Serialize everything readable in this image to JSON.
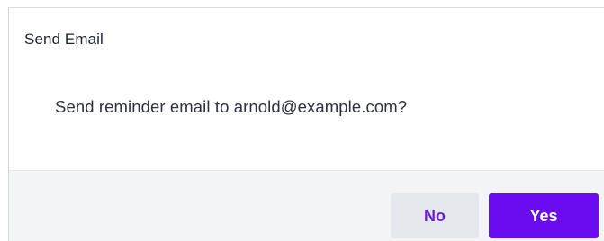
{
  "dialog": {
    "title": "Send Email",
    "message": "Send reminder email to arnold@example.com?",
    "buttons": {
      "no_label": "No",
      "yes_label": "Yes"
    }
  },
  "colors": {
    "primary": "#6b0bf0",
    "secondary_button_bg": "#e4e7ec",
    "secondary_button_text": "#6b21d6",
    "footer_bg": "#f3f4f6"
  }
}
